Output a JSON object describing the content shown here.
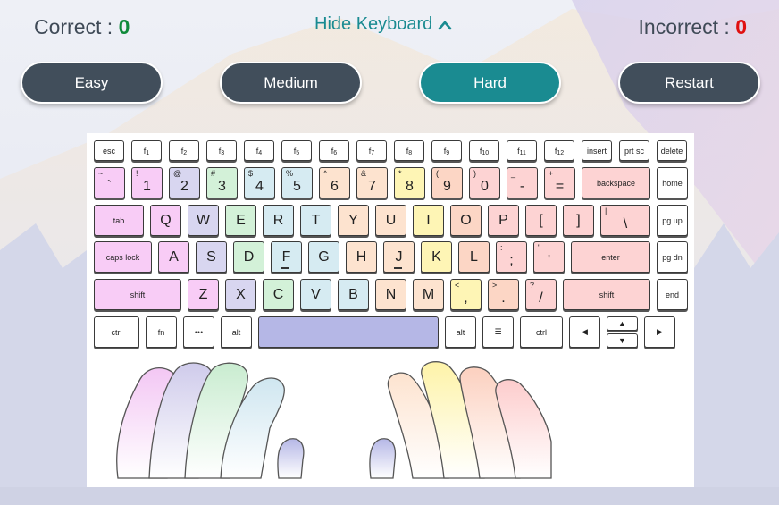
{
  "header": {
    "correct_label": "Correct : ",
    "correct_value": "0",
    "incorrect_label": "Incorrect : ",
    "incorrect_value": "0",
    "toggle_label": "Hide Keyboard"
  },
  "modes": [
    {
      "label": "Easy",
      "active": false
    },
    {
      "label": "Medium",
      "active": false
    },
    {
      "label": "Hard",
      "active": true
    },
    {
      "label": "Restart",
      "active": false
    }
  ],
  "colors": {
    "pinky": "#f8ccf6",
    "ring": "#d8d6f0",
    "middle": "#d3f1d8",
    "index": "#d6ebf2",
    "index_r": "#fde3cf",
    "middle_r": "#fef5b5",
    "ring_r": "#fcd6c5",
    "pinky_r": "#fdd3d3",
    "thumb": "#b5b7e6",
    "plain": "#ffffff"
  },
  "keyboard": {
    "row0": [
      {
        "main": "esc",
        "c": "plain"
      },
      {
        "main": "f",
        "sub": "1",
        "c": "plain"
      },
      {
        "main": "f",
        "sub": "2",
        "c": "plain"
      },
      {
        "main": "f",
        "sub": "3",
        "c": "plain"
      },
      {
        "main": "f",
        "sub": "4",
        "c": "plain"
      },
      {
        "main": "f",
        "sub": "5",
        "c": "plain"
      },
      {
        "main": "f",
        "sub": "6",
        "c": "plain"
      },
      {
        "main": "f",
        "sub": "7",
        "c": "plain"
      },
      {
        "main": "f",
        "sub": "8",
        "c": "plain"
      },
      {
        "main": "f",
        "sub": "9",
        "c": "plain"
      },
      {
        "main": "f",
        "sub": "10",
        "c": "plain"
      },
      {
        "main": "f",
        "sub": "11",
        "c": "plain"
      },
      {
        "main": "f",
        "sub": "12",
        "c": "plain"
      },
      {
        "main": "insert",
        "c": "plain"
      },
      {
        "main": "prt sc",
        "c": "plain"
      },
      {
        "main": "delete",
        "c": "plain"
      }
    ],
    "row1": [
      {
        "main": "`",
        "sup": "~",
        "c": "pinky"
      },
      {
        "main": "1",
        "sup": "!",
        "c": "pinky"
      },
      {
        "main": "2",
        "sup": "@",
        "c": "ring"
      },
      {
        "main": "3",
        "sup": "#",
        "c": "middle"
      },
      {
        "main": "4",
        "sup": "$",
        "c": "index"
      },
      {
        "main": "5",
        "sup": "%",
        "c": "index"
      },
      {
        "main": "6",
        "sup": "^",
        "c": "index_r"
      },
      {
        "main": "7",
        "sup": "&",
        "c": "index_r"
      },
      {
        "main": "8",
        "sup": "*",
        "c": "middle_r"
      },
      {
        "main": "9",
        "sup": "(",
        "c": "ring_r"
      },
      {
        "main": "0",
        "sup": ")",
        "c": "pinky_r"
      },
      {
        "main": "-",
        "sup": "_",
        "c": "pinky_r"
      },
      {
        "main": "=",
        "sup": "+",
        "c": "pinky_r"
      },
      {
        "main": "backspace",
        "c": "pinky_r"
      },
      {
        "main": "home",
        "c": "plain"
      }
    ],
    "row2": [
      {
        "main": "tab",
        "c": "pinky"
      },
      {
        "main": "Q",
        "c": "pinky"
      },
      {
        "main": "W",
        "c": "ring"
      },
      {
        "main": "E",
        "c": "middle"
      },
      {
        "main": "R",
        "c": "index"
      },
      {
        "main": "T",
        "c": "index"
      },
      {
        "main": "Y",
        "c": "index_r"
      },
      {
        "main": "U",
        "c": "index_r"
      },
      {
        "main": "I",
        "c": "middle_r"
      },
      {
        "main": "O",
        "c": "ring_r"
      },
      {
        "main": "P",
        "c": "pinky_r"
      },
      {
        "main": "[",
        "c": "pinky_r"
      },
      {
        "main": "]",
        "c": "pinky_r"
      },
      {
        "main": "\\",
        "sup": "|",
        "c": "pinky_r"
      },
      {
        "main": "pg up",
        "c": "plain"
      }
    ],
    "row3": [
      {
        "main": "caps lock",
        "c": "pinky"
      },
      {
        "main": "A",
        "c": "pinky"
      },
      {
        "main": "S",
        "c": "ring"
      },
      {
        "main": "D",
        "c": "middle"
      },
      {
        "main": "F",
        "c": "index"
      },
      {
        "main": "G",
        "c": "index"
      },
      {
        "main": "H",
        "c": "index_r"
      },
      {
        "main": "J",
        "c": "index_r"
      },
      {
        "main": "K",
        "c": "middle_r"
      },
      {
        "main": "L",
        "c": "ring_r"
      },
      {
        "main": ";",
        "sup": ":",
        "c": "pinky_r"
      },
      {
        "main": "'",
        "sup": "\"",
        "c": "pinky_r"
      },
      {
        "main": "enter",
        "c": "pinky_r"
      },
      {
        "main": "pg dn",
        "c": "plain"
      }
    ],
    "row4": [
      {
        "main": "shift",
        "c": "pinky"
      },
      {
        "main": "Z",
        "c": "pinky"
      },
      {
        "main": "X",
        "c": "ring"
      },
      {
        "main": "C",
        "c": "middle"
      },
      {
        "main": "V",
        "c": "index"
      },
      {
        "main": "B",
        "c": "index"
      },
      {
        "main": "N",
        "c": "index_r"
      },
      {
        "main": "M",
        "c": "index_r"
      },
      {
        "main": ",",
        "sup": "<",
        "c": "middle_r"
      },
      {
        "main": ".",
        "sup": ">",
        "c": "ring_r"
      },
      {
        "main": "/",
        "sup": "?",
        "c": "pinky_r"
      },
      {
        "main": "shift",
        "c": "pinky_r"
      },
      {
        "main": "end",
        "c": "plain"
      }
    ],
    "row5": [
      {
        "main": "ctrl",
        "c": "plain"
      },
      {
        "main": "fn",
        "c": "plain"
      },
      {
        "main": "•••",
        "c": "plain"
      },
      {
        "main": "alt",
        "c": "plain"
      },
      {
        "main": "",
        "c": "thumb"
      },
      {
        "main": "alt",
        "c": "plain"
      },
      {
        "main": "☰",
        "c": "plain"
      },
      {
        "main": "ctrl",
        "c": "plain"
      },
      {
        "main": "◀",
        "c": "plain"
      },
      {
        "main": "▲",
        "c": "plain"
      },
      {
        "main": "▼",
        "c": "plain"
      },
      {
        "main": "▶",
        "c": "plain"
      }
    ]
  }
}
